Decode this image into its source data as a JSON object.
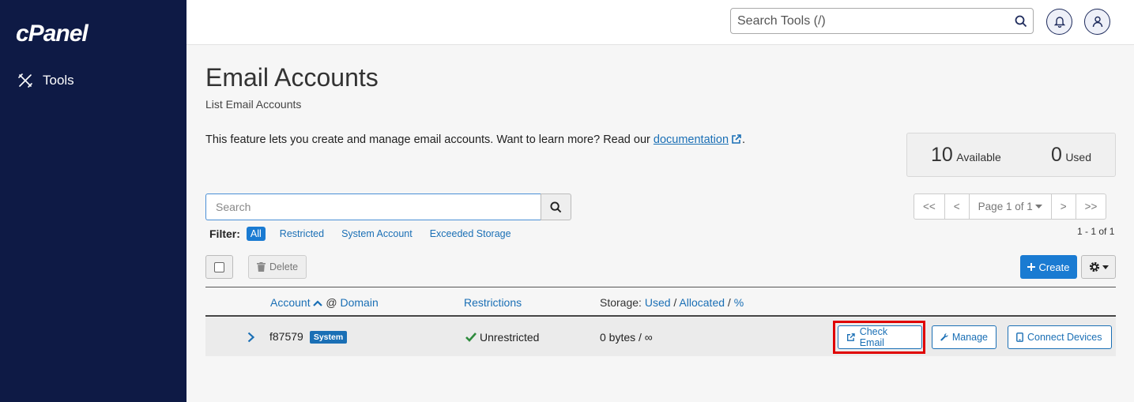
{
  "sidebar": {
    "logo": "cPanel",
    "items": [
      {
        "label": "Tools"
      }
    ]
  },
  "topbar": {
    "search_placeholder": "Search Tools (/)"
  },
  "page": {
    "title": "Email Accounts",
    "subtitle": "List Email Accounts",
    "description": "This feature lets you create and manage email accounts. Want to learn more? Read our",
    "doc_link": "documentation",
    "desc_end": "."
  },
  "stats": {
    "available_count": "10",
    "available_label": "Available",
    "used_count": "0",
    "used_label": "Used"
  },
  "search": {
    "placeholder": "Search"
  },
  "filter": {
    "label": "Filter:",
    "options": [
      "All",
      "Restricted",
      "System Account",
      "Exceeded Storage"
    ],
    "active": "All"
  },
  "pager": {
    "first": "<<",
    "prev": "<",
    "page": "Page 1 of 1",
    "next": ">",
    "last": ">>",
    "range": "1 - 1 of 1"
  },
  "toolbar": {
    "delete": "Delete",
    "create": "Create"
  },
  "table": {
    "col_account": "Account",
    "col_at": "@",
    "col_domain": "Domain",
    "col_restrictions": "Restrictions",
    "col_storage": "Storage:",
    "col_used": "Used",
    "col_allocated": "Allocated",
    "col_pct": "%",
    "slash": "/",
    "rows": [
      {
        "account": "f87579",
        "badge": "System",
        "restriction": "Unrestricted",
        "storage": "0 bytes / ∞",
        "actions": {
          "check_email": "Check Email",
          "manage": "Manage",
          "connect": "Connect Devices"
        }
      }
    ]
  },
  "colors": {
    "sidebar_bg": "#0e1a45",
    "accent": "#1a7bd2",
    "link": "#1a6fb5",
    "highlight": "#e00000",
    "success": "#2e8b3d"
  }
}
